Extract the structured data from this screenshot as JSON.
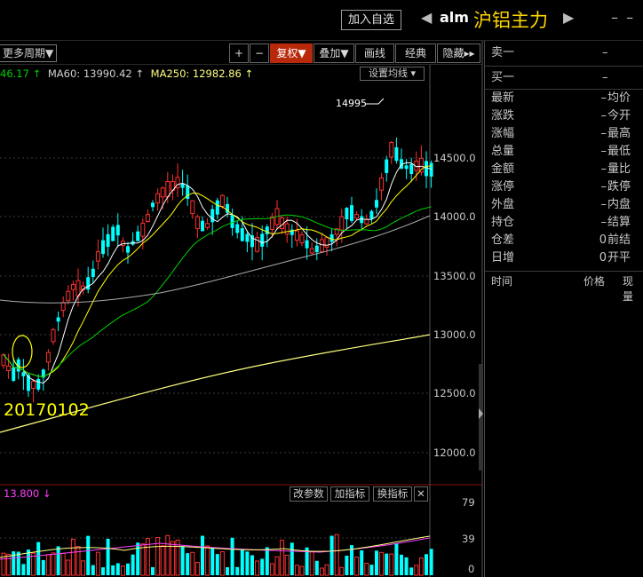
{
  "title_bar": {
    "add_watchlist": "加入自选",
    "prev_arrow": "◀",
    "next_arrow": "▶",
    "code": "alm",
    "name": "沪铝主力",
    "menu": "–  –"
  },
  "toolbar": {
    "period": "更多周期▼",
    "plus": "+",
    "minus": "−",
    "adjust": "复权▼",
    "overlay": "叠加▼",
    "draw": "画线",
    "classic": "经典",
    "hide": "隐藏▸▸"
  },
  "ma_legend": {
    "ma_prev": "46.17 ↑",
    "ma60": "MA60: 13990.42 ↑",
    "ma250": "MA250: 12982.86 ↑",
    "set_ma": "设置均线 ▾"
  },
  "price_axis": [
    "14500.0",
    "14000.0",
    "13500.0",
    "13000.0",
    "12500.0",
    "12000.0"
  ],
  "peak_label": "14995",
  "date_label": "20170102",
  "indicator": {
    "value": "13.800 ↓",
    "params": "改参数",
    "add": "加指标",
    "switch": "换指标",
    "close": "✕",
    "axis": [
      "79",
      "39",
      "0"
    ]
  },
  "quote_panel": {
    "sell1": "卖一",
    "sell1_val": "–",
    "buy1": "买一",
    "buy1_val": "–",
    "rows": [
      {
        "a": "最新",
        "b": "–",
        "c": "均价"
      },
      {
        "a": "涨跌",
        "b": "–",
        "c": "今开"
      },
      {
        "a": "涨幅",
        "b": "–",
        "c": "最高"
      },
      {
        "a": "总量",
        "b": "–",
        "c": "最低"
      },
      {
        "a": "金额",
        "b": "–",
        "c": "量比"
      },
      {
        "a": "涨停",
        "b": "–",
        "c": "跌停"
      },
      {
        "a": "外盘",
        "b": "–",
        "c": "内盘"
      },
      {
        "a": "持仓",
        "b": "–",
        "c": "结算"
      },
      {
        "a": "仓差",
        "b": "0",
        "c": "前结"
      },
      {
        "a": "日增",
        "b": "0",
        "c": "开平"
      }
    ],
    "trade_headers": [
      "时间",
      "价格",
      "现量"
    ]
  },
  "colors": {
    "up": "#ff3030",
    "down": "#00ffff",
    "ma_white": "#ffffff",
    "ma_yellow": "#ffff00",
    "ma_green": "#00d000",
    "ma_grey": "#aaaaaa",
    "ma250": "#ffff80",
    "accent": "#b8290c"
  }
}
